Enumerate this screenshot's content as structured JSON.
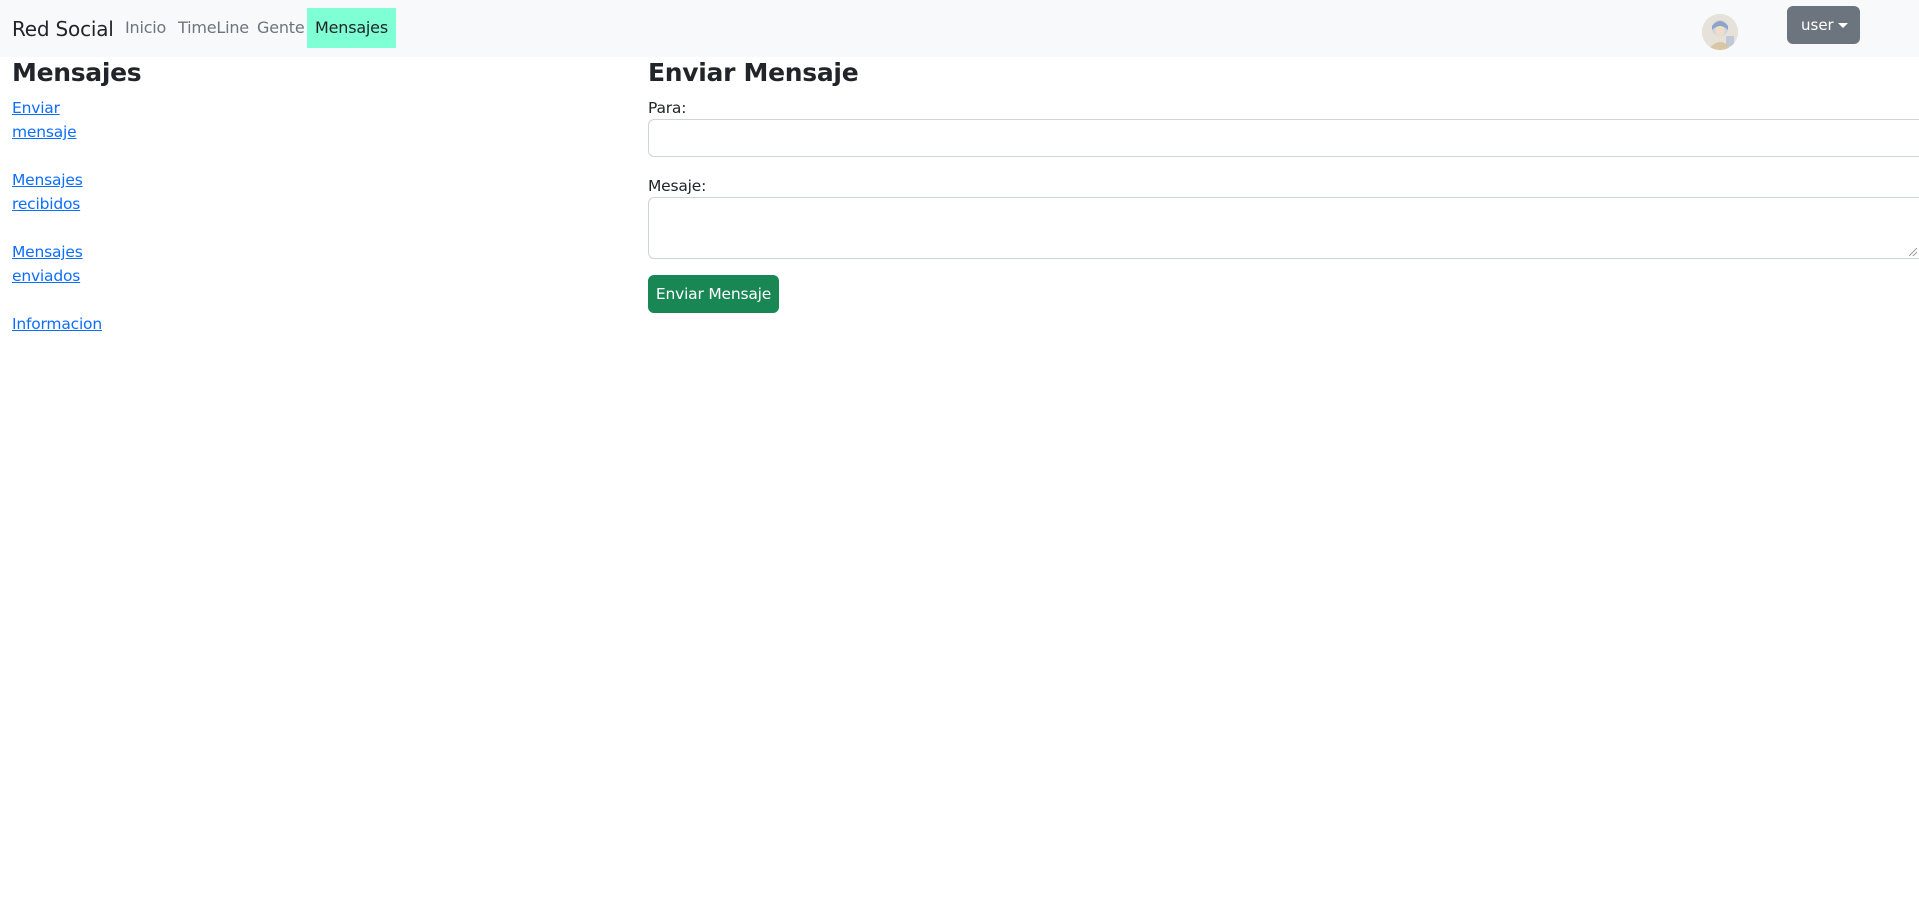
{
  "navbar": {
    "brand": "Red Social",
    "links": [
      {
        "label": "Inicio"
      },
      {
        "label": "TimeLine"
      },
      {
        "label": "Gente"
      },
      {
        "label": "Mensajes",
        "active": true
      }
    ],
    "active_bg": "#7fffd4",
    "user_button_label": "user",
    "avatar_icon": "avatar-icon"
  },
  "sidebar": {
    "title": "Mensajes",
    "links": [
      {
        "label": "Enviar mensaje"
      },
      {
        "label": "Mensajes recibidos"
      },
      {
        "label": "Mensajes enviados"
      },
      {
        "label": "Informacion"
      }
    ],
    "link_color": "#0d6efd"
  },
  "form": {
    "title": "Enviar Mensaje",
    "to_label": "Para:",
    "to_value": "",
    "message_label": "Mesaje:",
    "message_value": "",
    "submit_label": "Enviar Mensaje",
    "submit_color": "#198754"
  }
}
